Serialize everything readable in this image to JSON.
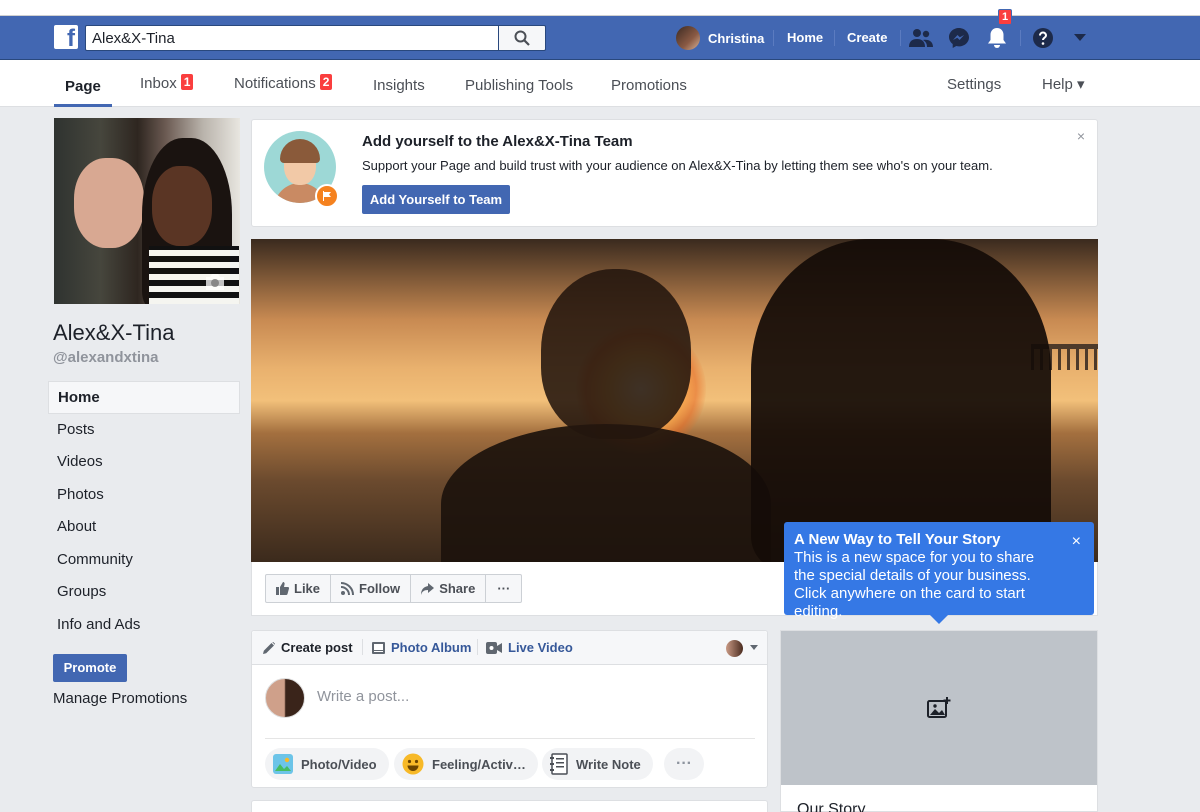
{
  "topbar": {
    "search_value": "Alex&X-Tina",
    "user_name": "Christina",
    "home_label": "Home",
    "create_label": "Create",
    "notification_count": "1",
    "brand_color": "#4267b2"
  },
  "page_nav": {
    "page_label": "Page",
    "inbox_label": "Inbox",
    "inbox_count": "1",
    "notifications_label": "Notifications",
    "notifications_count": "2",
    "insights_label": "Insights",
    "publishing_tools_label": "Publishing Tools",
    "promotions_label": "Promotions",
    "settings_label": "Settings",
    "help_label": "Help ▾"
  },
  "sidebar": {
    "page_name": "Alex&X-Tina",
    "page_handle": "@alexandxtina",
    "items": [
      {
        "label": "Home"
      },
      {
        "label": "Posts"
      },
      {
        "label": "Videos"
      },
      {
        "label": "Photos"
      },
      {
        "label": "About"
      },
      {
        "label": "Community"
      },
      {
        "label": "Groups"
      },
      {
        "label": "Info and Ads"
      }
    ],
    "promote_label": "Promote",
    "manage_promotions_label": "Manage Promotions"
  },
  "team_card": {
    "title": "Add yourself to the Alex&X-Tina Team",
    "description": "Support your Page and build trust with your audience on Alex&X-Tina by letting them see who's on your team.",
    "button_label": "Add Yourself to Team",
    "close_glyph": "×"
  },
  "cover_actions": {
    "like_label": "Like",
    "follow_label": "Follow",
    "share_label": "Share",
    "more_label": "···"
  },
  "tooltip": {
    "title": "A New Way to Tell Your Story",
    "body": "This is a new space for you to share the special details of your business. Click anywhere on the card to start editing.",
    "close_glyph": "×"
  },
  "composer": {
    "create_post_label": "Create post",
    "photo_album_label": "Photo Album",
    "live_video_label": "Live Video",
    "placeholder": "Write a post...",
    "photo_video_label": "Photo/Video",
    "feeling_label": "Feeling/Activ…",
    "write_note_label": "Write Note",
    "more_label": "···"
  },
  "story_card": {
    "label": "Our Story"
  }
}
